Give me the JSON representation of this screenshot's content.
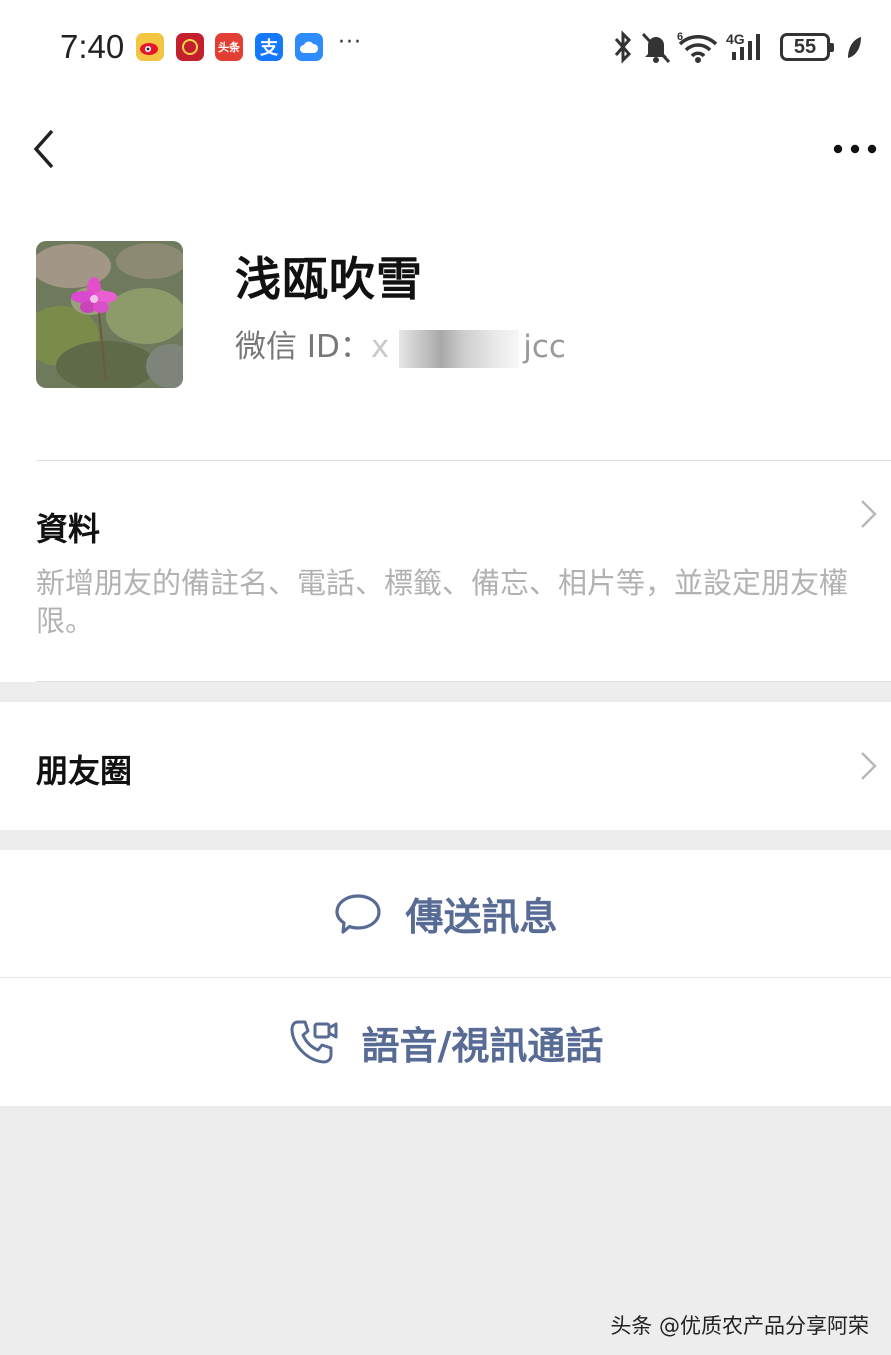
{
  "status_bar": {
    "time": "7:40",
    "app_icons": [
      "weibo-icon",
      "app-red-icon",
      "toutiao-icon",
      "alipay-icon",
      "cloud-icon"
    ],
    "toutiao_label": "头条",
    "alipay_label": "支",
    "more_dots": "···",
    "network": "4G",
    "network_sim": "6",
    "battery": "55"
  },
  "nav": {
    "back_icon": "chevron-left-icon",
    "more_icon": "more-dots-icon"
  },
  "profile": {
    "name": "浅瓯吹雪",
    "wechat_id_label": "微信 ID：",
    "wechat_id_prefix": "x",
    "wechat_id_suffix": "jcc"
  },
  "info": {
    "title": "資料",
    "description": "新增朋友的備註名、電話、標籤、備忘、相片等，並設定朋友權限。"
  },
  "moments": {
    "title": "朋友圈"
  },
  "actions": {
    "send_message": "傳送訊息",
    "call": "語音/視訊通話",
    "accent": "#576b95"
  },
  "watermark": "头条 @优质农产品分享阿荣"
}
